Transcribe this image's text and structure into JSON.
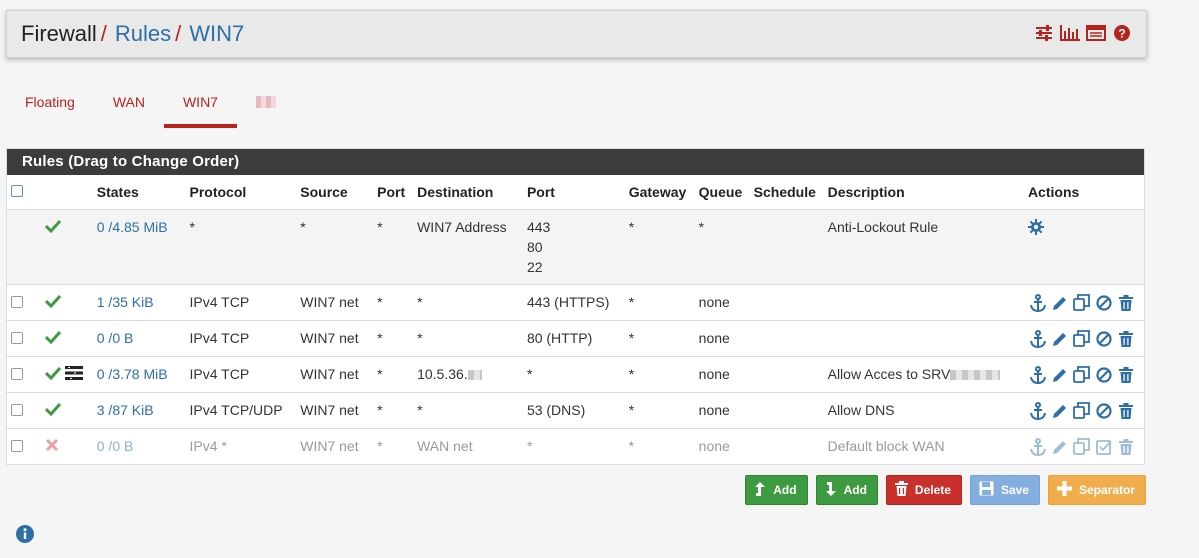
{
  "breadcrumb": {
    "part1": "Firewall",
    "part2": "Rules",
    "part3": "WIN7",
    "sep": "/"
  },
  "header_icons": [
    "sliders-icon",
    "bar-chart-icon",
    "table-icon",
    "help-icon"
  ],
  "tabs": {
    "floating": "Floating",
    "wan": "WAN",
    "win7": "WIN7",
    "active": "WIN7"
  },
  "panel": {
    "title": "Rules (Drag to Change Order)"
  },
  "columns": [
    "States",
    "Protocol",
    "Source",
    "Port",
    "Destination",
    "Port",
    "Gateway",
    "Queue",
    "Schedule",
    "Description",
    "Actions"
  ],
  "rows": [
    {
      "states": "0 /4.85 MiB",
      "protocol": "*",
      "source": "*",
      "sport": "*",
      "destination": "WIN7 Address",
      "dport1": "443",
      "dport2": "80",
      "dport3": "22",
      "gateway": "*",
      "queue": "*",
      "description": "Anti-Lockout Rule",
      "status": "pass"
    },
    {
      "states": "1 /35 KiB",
      "protocol": "IPv4 TCP",
      "source": "WIN7 net",
      "sport": "*",
      "destination": "*",
      "dport": "443 (HTTPS)",
      "gateway": "*",
      "queue": "none",
      "description": "",
      "status": "pass"
    },
    {
      "states": "0 /0 B",
      "protocol": "IPv4 TCP",
      "source": "WIN7 net",
      "sport": "*",
      "destination": "*",
      "dport": "80 (HTTP)",
      "gateway": "*",
      "queue": "none",
      "description": "",
      "status": "pass"
    },
    {
      "states": "0 /3.78 MiB",
      "protocol": "IPv4 TCP",
      "source": "WIN7 net",
      "sport": "*",
      "destination": "10.5.36.",
      "dport": "*",
      "gateway": "*",
      "queue": "none",
      "description": "Allow Acces to SRV",
      "status": "pass"
    },
    {
      "states": "3 /87 KiB",
      "protocol": "IPv4 TCP/UDP",
      "source": "WIN7 net",
      "sport": "*",
      "destination": "*",
      "dport": "53 (DNS)",
      "gateway": "*",
      "queue": "none",
      "description": "Allow DNS",
      "status": "pass"
    },
    {
      "states": "0 /0 B",
      "protocol": "IPv4 *",
      "source": "WIN7 net",
      "sport": "*",
      "destination": "WAN net",
      "dport": "*",
      "gateway": "*",
      "queue": "none",
      "description": "Default block WAN",
      "status": "block"
    }
  ],
  "buttons": {
    "add_top": "Add",
    "add_bottom": "Add",
    "delete": "Delete",
    "save": "Save",
    "separator": "Separator"
  },
  "colors": {
    "pass": "#3d9a40",
    "block": "#e8a0a0",
    "accent": "#b5231f",
    "link": "#2e6ea6"
  }
}
